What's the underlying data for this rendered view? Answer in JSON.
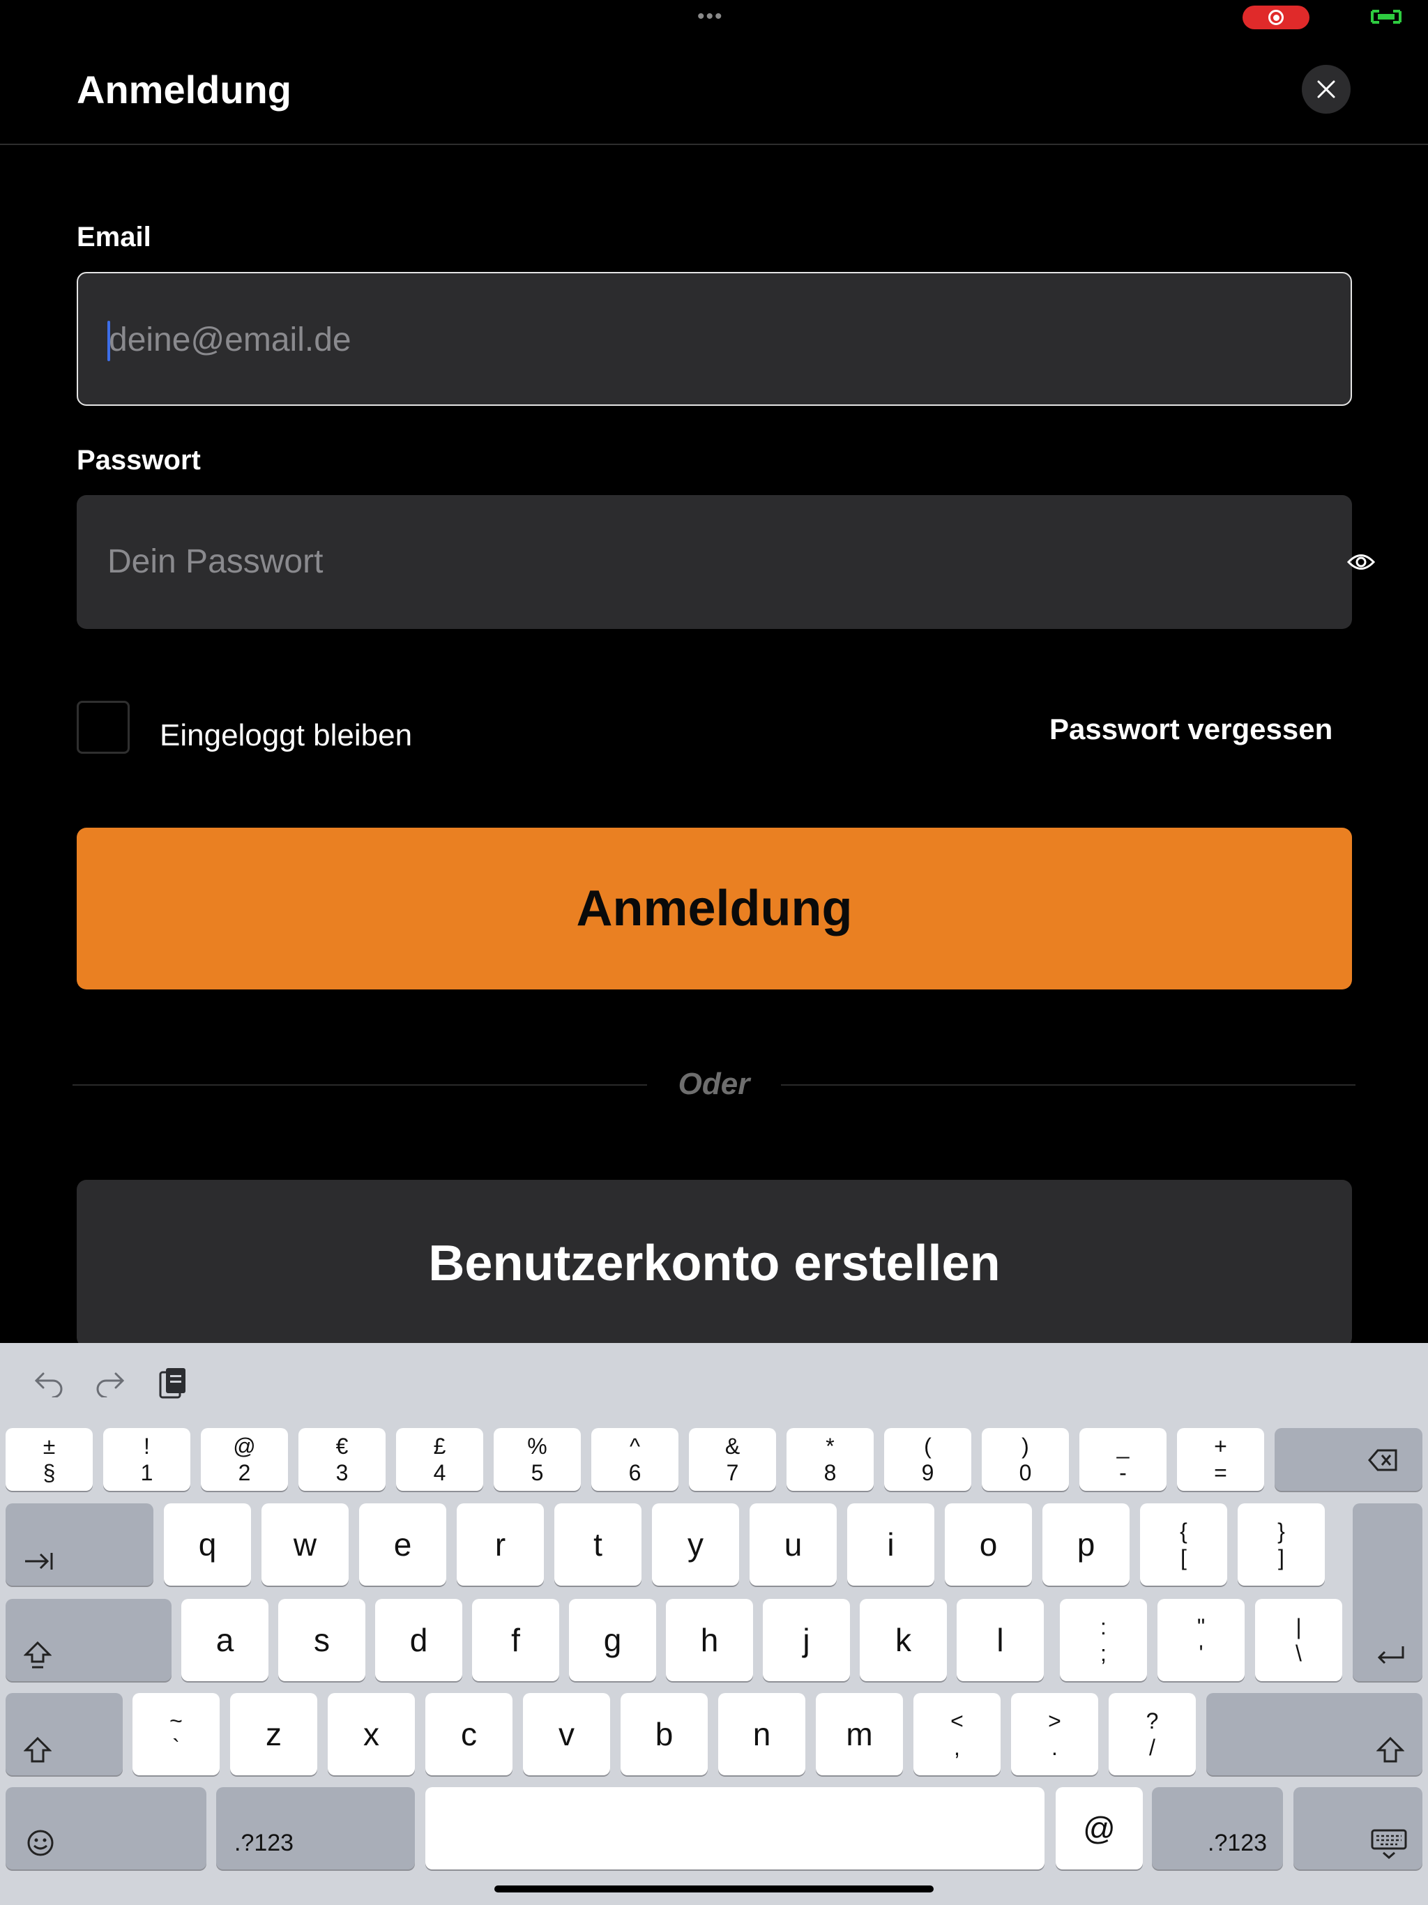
{
  "status": {
    "more_dots": "•••"
  },
  "header": {
    "title": "Anmeldung"
  },
  "form": {
    "email_label": "Email",
    "email_placeholder": "deine@email.de",
    "password_label": "Passwort",
    "password_placeholder": "Dein Passwort",
    "remember_label": "Eingeloggt bleiben",
    "forgot_label": "Passwort vergessen",
    "submit_label": "Anmeldung",
    "divider_label": "Oder",
    "create_account_label": "Benutzerkonto erstellen"
  },
  "colors": {
    "accent": "#ea8022",
    "field_bg": "#2c2c2e",
    "recording": "#e02a2a"
  },
  "keyboard": {
    "row1": [
      {
        "top": "±",
        "bot": "§"
      },
      {
        "top": "!",
        "bot": "1"
      },
      {
        "top": "@",
        "bot": "2"
      },
      {
        "top": "€",
        "bot": "3"
      },
      {
        "top": "£",
        "bot": "4"
      },
      {
        "top": "%",
        "bot": "5"
      },
      {
        "top": "^",
        "bot": "6"
      },
      {
        "top": "&",
        "bot": "7"
      },
      {
        "top": "*",
        "bot": "8"
      },
      {
        "top": "(",
        "bot": "9"
      },
      {
        "top": ")",
        "bot": "0"
      },
      {
        "top": "_",
        "bot": "-"
      },
      {
        "top": "+",
        "bot": "="
      }
    ],
    "row2": [
      "q",
      "w",
      "e",
      "r",
      "t",
      "y",
      "u",
      "i",
      "o",
      "p"
    ],
    "row2_sym": [
      {
        "top": "{",
        "bot": "["
      },
      {
        "top": "}",
        "bot": "]"
      }
    ],
    "row3": [
      "a",
      "s",
      "d",
      "f",
      "g",
      "h",
      "j",
      "k",
      "l"
    ],
    "row3_sym": [
      {
        "top": ":",
        "bot": ";"
      },
      {
        "top": "\"",
        "bot": "'"
      },
      {
        "top": "|",
        "bot": "\\"
      }
    ],
    "row4_sym_left": {
      "top": "~",
      "bot": "`"
    },
    "row4": [
      "z",
      "x",
      "c",
      "v",
      "b",
      "n",
      "m"
    ],
    "row4_sym": [
      {
        "top": "<",
        "bot": ","
      },
      {
        "top": ">",
        "bot": "."
      },
      {
        "top": "?",
        "bot": "/"
      }
    ],
    "at_key": "@",
    "numbers_label": ".?123"
  }
}
